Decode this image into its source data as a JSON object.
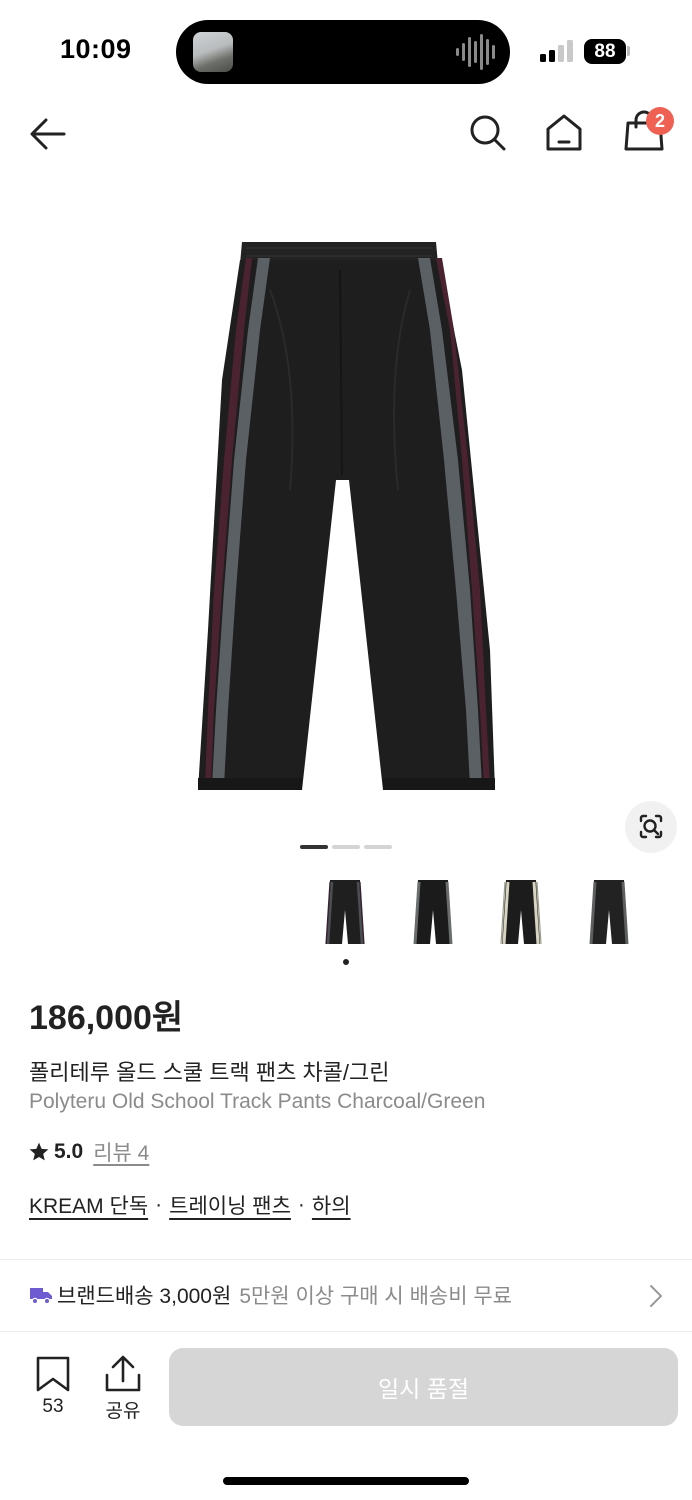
{
  "status_bar": {
    "time": "10:09",
    "battery": "88",
    "icons": [
      "signal-icon",
      "battery-icon",
      "audio-wave-icon"
    ]
  },
  "header": {
    "icons": [
      "back-arrow-icon",
      "search-icon",
      "home-icon",
      "shopping-bag-icon"
    ],
    "cart_count": "2"
  },
  "gallery": {
    "active_index": 0,
    "page_count": 3,
    "thumbnails": [
      {
        "name": "charcoal-green",
        "stripe_color": "#4a4f52",
        "accent_color": "#3a2030"
      },
      {
        "name": "black-grey",
        "stripe_color": "#6a6d6e",
        "accent_color": "#2b2b2b"
      },
      {
        "name": "black-cream",
        "stripe_color": "#d8d4c2",
        "accent_color": "#9a9a8a"
      },
      {
        "name": "black-charcoal",
        "stripe_color": "#5d5f60",
        "accent_color": "#3b3d3e"
      }
    ],
    "thumbnail_selected": 0
  },
  "product": {
    "price": "186,000원",
    "name_ko": "폴리테루 올드 스쿨 트랙 팬츠 차콜/그린",
    "name_en": "Polyteru Old School Track Pants Charcoal/Green",
    "rating": "5.0",
    "review_label": "리뷰 4",
    "categories": [
      "KREAM 단독",
      "트레이닝 팬츠",
      "하의"
    ],
    "category_separator": "·"
  },
  "shipping": {
    "label": "브랜드배송 3,000원",
    "note": "5만원 이상 구매 시 배송비 무료"
  },
  "bottom_bar": {
    "bookmark_count": "53",
    "share_label": "공유",
    "cta_label": "일시 품절"
  },
  "colors": {
    "badge": "#ef6253",
    "muted_text": "#8b8b8b",
    "cta_disabled": "#d6d6d6",
    "truck": "#6e5ad1"
  }
}
